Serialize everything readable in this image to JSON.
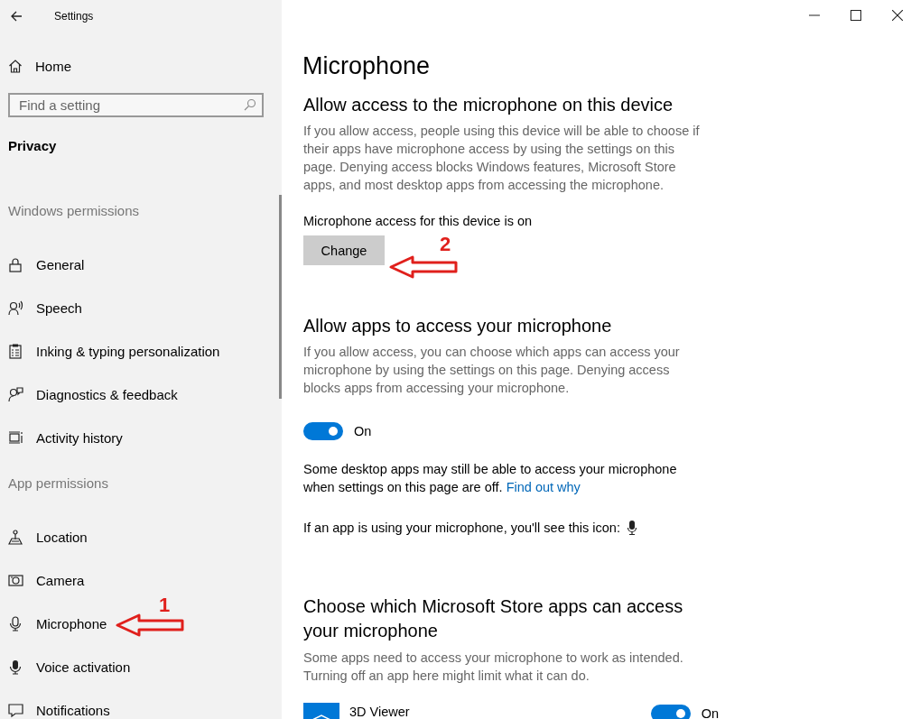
{
  "window": {
    "title": "Settings"
  },
  "sidebar": {
    "home": "Home",
    "search": {
      "placeholder": "Find a setting"
    },
    "section": "Privacy",
    "groups": [
      {
        "heading": "Windows permissions",
        "items": [
          {
            "label": "General"
          },
          {
            "label": "Speech"
          },
          {
            "label": "Inking & typing personalization"
          },
          {
            "label": "Diagnostics & feedback"
          },
          {
            "label": "Activity history"
          }
        ]
      },
      {
        "heading": "App permissions",
        "items": [
          {
            "label": "Location"
          },
          {
            "label": "Camera"
          },
          {
            "label": "Microphone"
          },
          {
            "label": "Voice activation"
          },
          {
            "label": "Notifications"
          }
        ]
      }
    ]
  },
  "page": {
    "title": "Microphone",
    "device_section": {
      "heading": "Allow access to the microphone on this device",
      "description": "If you allow access, people using this device will be able to choose if their apps have microphone access by using the settings on this page. Denying access blocks Windows features, Microsoft Store apps, and most desktop apps from accessing the microphone.",
      "status": "Microphone access for this device is on",
      "button": "Change"
    },
    "apps_section": {
      "heading": "Allow apps to access your microphone",
      "description": "If you allow access, you can choose which apps can access your microphone by using the settings on this page. Denying access blocks apps from accessing your microphone.",
      "toggle": {
        "on": true,
        "label": "On"
      },
      "note": "Some desktop apps may still be able to access your microphone when settings on this page are off.",
      "link": "Find out why",
      "icon_note": "If an app is using your microphone, you'll see this icon:"
    },
    "store_section": {
      "heading": "Choose which Microsoft Store apps can access your microphone",
      "description": "Some apps need to access your microphone to work as intended. Turning off an app here might limit what it can do.",
      "apps": [
        {
          "name": "3D Viewer",
          "on": true,
          "label": "On"
        }
      ]
    }
  },
  "annotations": [
    {
      "label": "1"
    },
    {
      "label": "2"
    }
  ]
}
